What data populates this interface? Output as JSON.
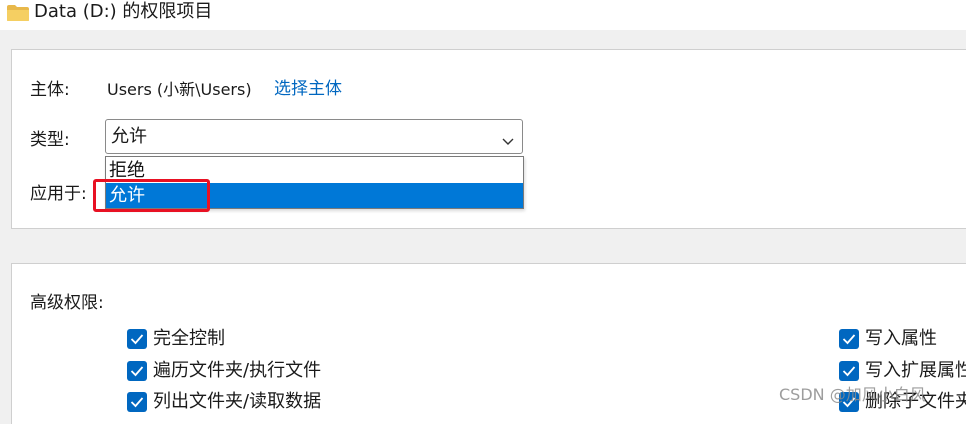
{
  "window": {
    "title": "Data (D:) 的权限项目",
    "icon": "folder-icon"
  },
  "principal": {
    "label": "主体:",
    "value": "Users (小新\\Users)",
    "select_link": "选择主体"
  },
  "type": {
    "label": "类型:",
    "selected": "允许",
    "options": [
      "拒绝",
      "允许"
    ],
    "highlighted_option": "允许"
  },
  "applies_to": {
    "label": "应用于:"
  },
  "advanced": {
    "label": "高级权限:",
    "left_column": [
      {
        "label": "完全控制",
        "checked": true
      },
      {
        "label": "遍历文件夹/执行文件",
        "checked": true
      },
      {
        "label": "列出文件夹/读取数据",
        "checked": true
      }
    ],
    "right_column": [
      {
        "label": "写入属性",
        "checked": true
      },
      {
        "label": "写入扩展属性",
        "checked": true
      },
      {
        "label": "删除子文件夹",
        "checked": true
      }
    ]
  },
  "watermark": "CSDN @加风小白风",
  "colors": {
    "accent": "#0067c0",
    "selection": "#0078d7",
    "highlight_box": "#e81123"
  }
}
